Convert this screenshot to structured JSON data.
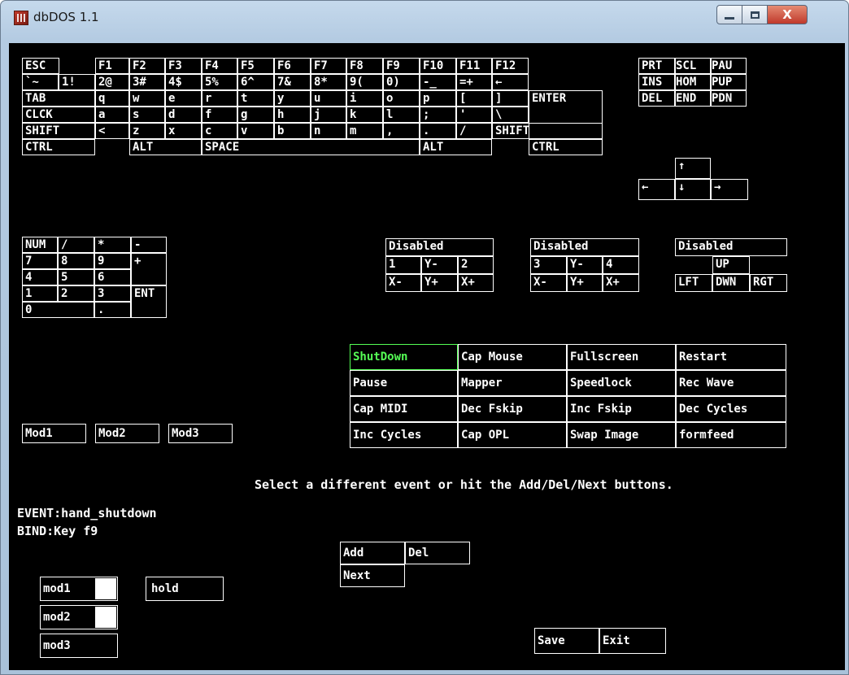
{
  "window": {
    "title": "dbDOS 1.1",
    "colors": {
      "screen_bg": "#000000",
      "fg": "#ffffff",
      "highlight": "#55ff55",
      "close_btn": "#c0392b"
    },
    "controls": {
      "minimize_icon": "minimize-icon",
      "maximize_icon": "maximize-icon",
      "close_label": "X"
    }
  },
  "keyboard": {
    "function_row": [
      "ESC",
      "F1",
      "F2",
      "F3",
      "F4",
      "F5",
      "F6",
      "F7",
      "F8",
      "F9",
      "F10",
      "F11",
      "F12"
    ],
    "number_row": [
      "`~",
      "1!",
      "2@",
      "3#",
      "4$",
      "5%",
      "6^",
      "7&",
      "8*",
      "9(",
      "0)",
      "-_",
      "=+",
      "←"
    ],
    "tab_row": [
      "TAB",
      "q",
      "w",
      "e",
      "r",
      "t",
      "y",
      "u",
      "i",
      "o",
      "p",
      "[",
      "]",
      "ENTER"
    ],
    "caps_row": [
      "CLCK",
      "a",
      "s",
      "d",
      "f",
      "g",
      "h",
      "j",
      "k",
      "l",
      ";",
      "'",
      "\\"
    ],
    "shift_row": [
      "SHIFT",
      "<",
      "z",
      "x",
      "c",
      "v",
      "b",
      "n",
      "m",
      ",",
      ".",
      "/",
      "SHIFT"
    ],
    "ctrl_row": [
      "CTRL",
      "ALT",
      "SPACE",
      "ALT",
      "CTRL"
    ],
    "nav_keys": [
      "PRT",
      "SCL",
      "PAU",
      "INS",
      "HOM",
      "PUP",
      "DEL",
      "END",
      "PDN"
    ],
    "arrows": [
      "↑",
      "←",
      "↓",
      "→"
    ],
    "numpad": [
      "NUM",
      "/",
      "*",
      "-",
      "7",
      "8",
      "9",
      "+",
      "4",
      "5",
      "6",
      "1",
      "2",
      "3",
      "ENT",
      "0",
      "."
    ]
  },
  "joysticks": {
    "joy1": [
      "Disabled",
      "1",
      "Y-",
      "2",
      "X-",
      "Y+",
      "X+"
    ],
    "joy2": [
      "Disabled",
      "3",
      "Y-",
      "4",
      "X-",
      "Y+",
      "X+"
    ],
    "hat": [
      "Disabled",
      "UP",
      "LFT",
      "DWN",
      "RGT"
    ]
  },
  "events": {
    "row1": [
      "ShutDown",
      "Cap Mouse",
      "Fullscreen",
      "Restart"
    ],
    "row2": [
      "Pause",
      "Mapper",
      "Speedlock",
      "Rec Wave"
    ],
    "row3": [
      "Cap MIDI",
      "Dec Fskip",
      "Inc Fskip",
      "Dec Cycles"
    ],
    "row4": [
      "Inc Cycles",
      "Cap OPL",
      "Swap Image",
      "formfeed"
    ]
  },
  "mods": [
    "Mod1",
    "Mod2",
    "Mod3"
  ],
  "info": {
    "message": "Select a different event or hit the Add/Del/Next buttons.",
    "event_line": "EVENT:hand_shutdown",
    "bind_line": "BIND:Key f9"
  },
  "actions": {
    "add": "Add",
    "del": "Del",
    "next": "Next"
  },
  "options": {
    "mod1": "mod1",
    "mod2": "mod2",
    "mod3": "mod3",
    "hold": "hold",
    "mod1_checked": false,
    "mod2_checked": false
  },
  "footer": {
    "save": "Save",
    "exit": "Exit"
  }
}
